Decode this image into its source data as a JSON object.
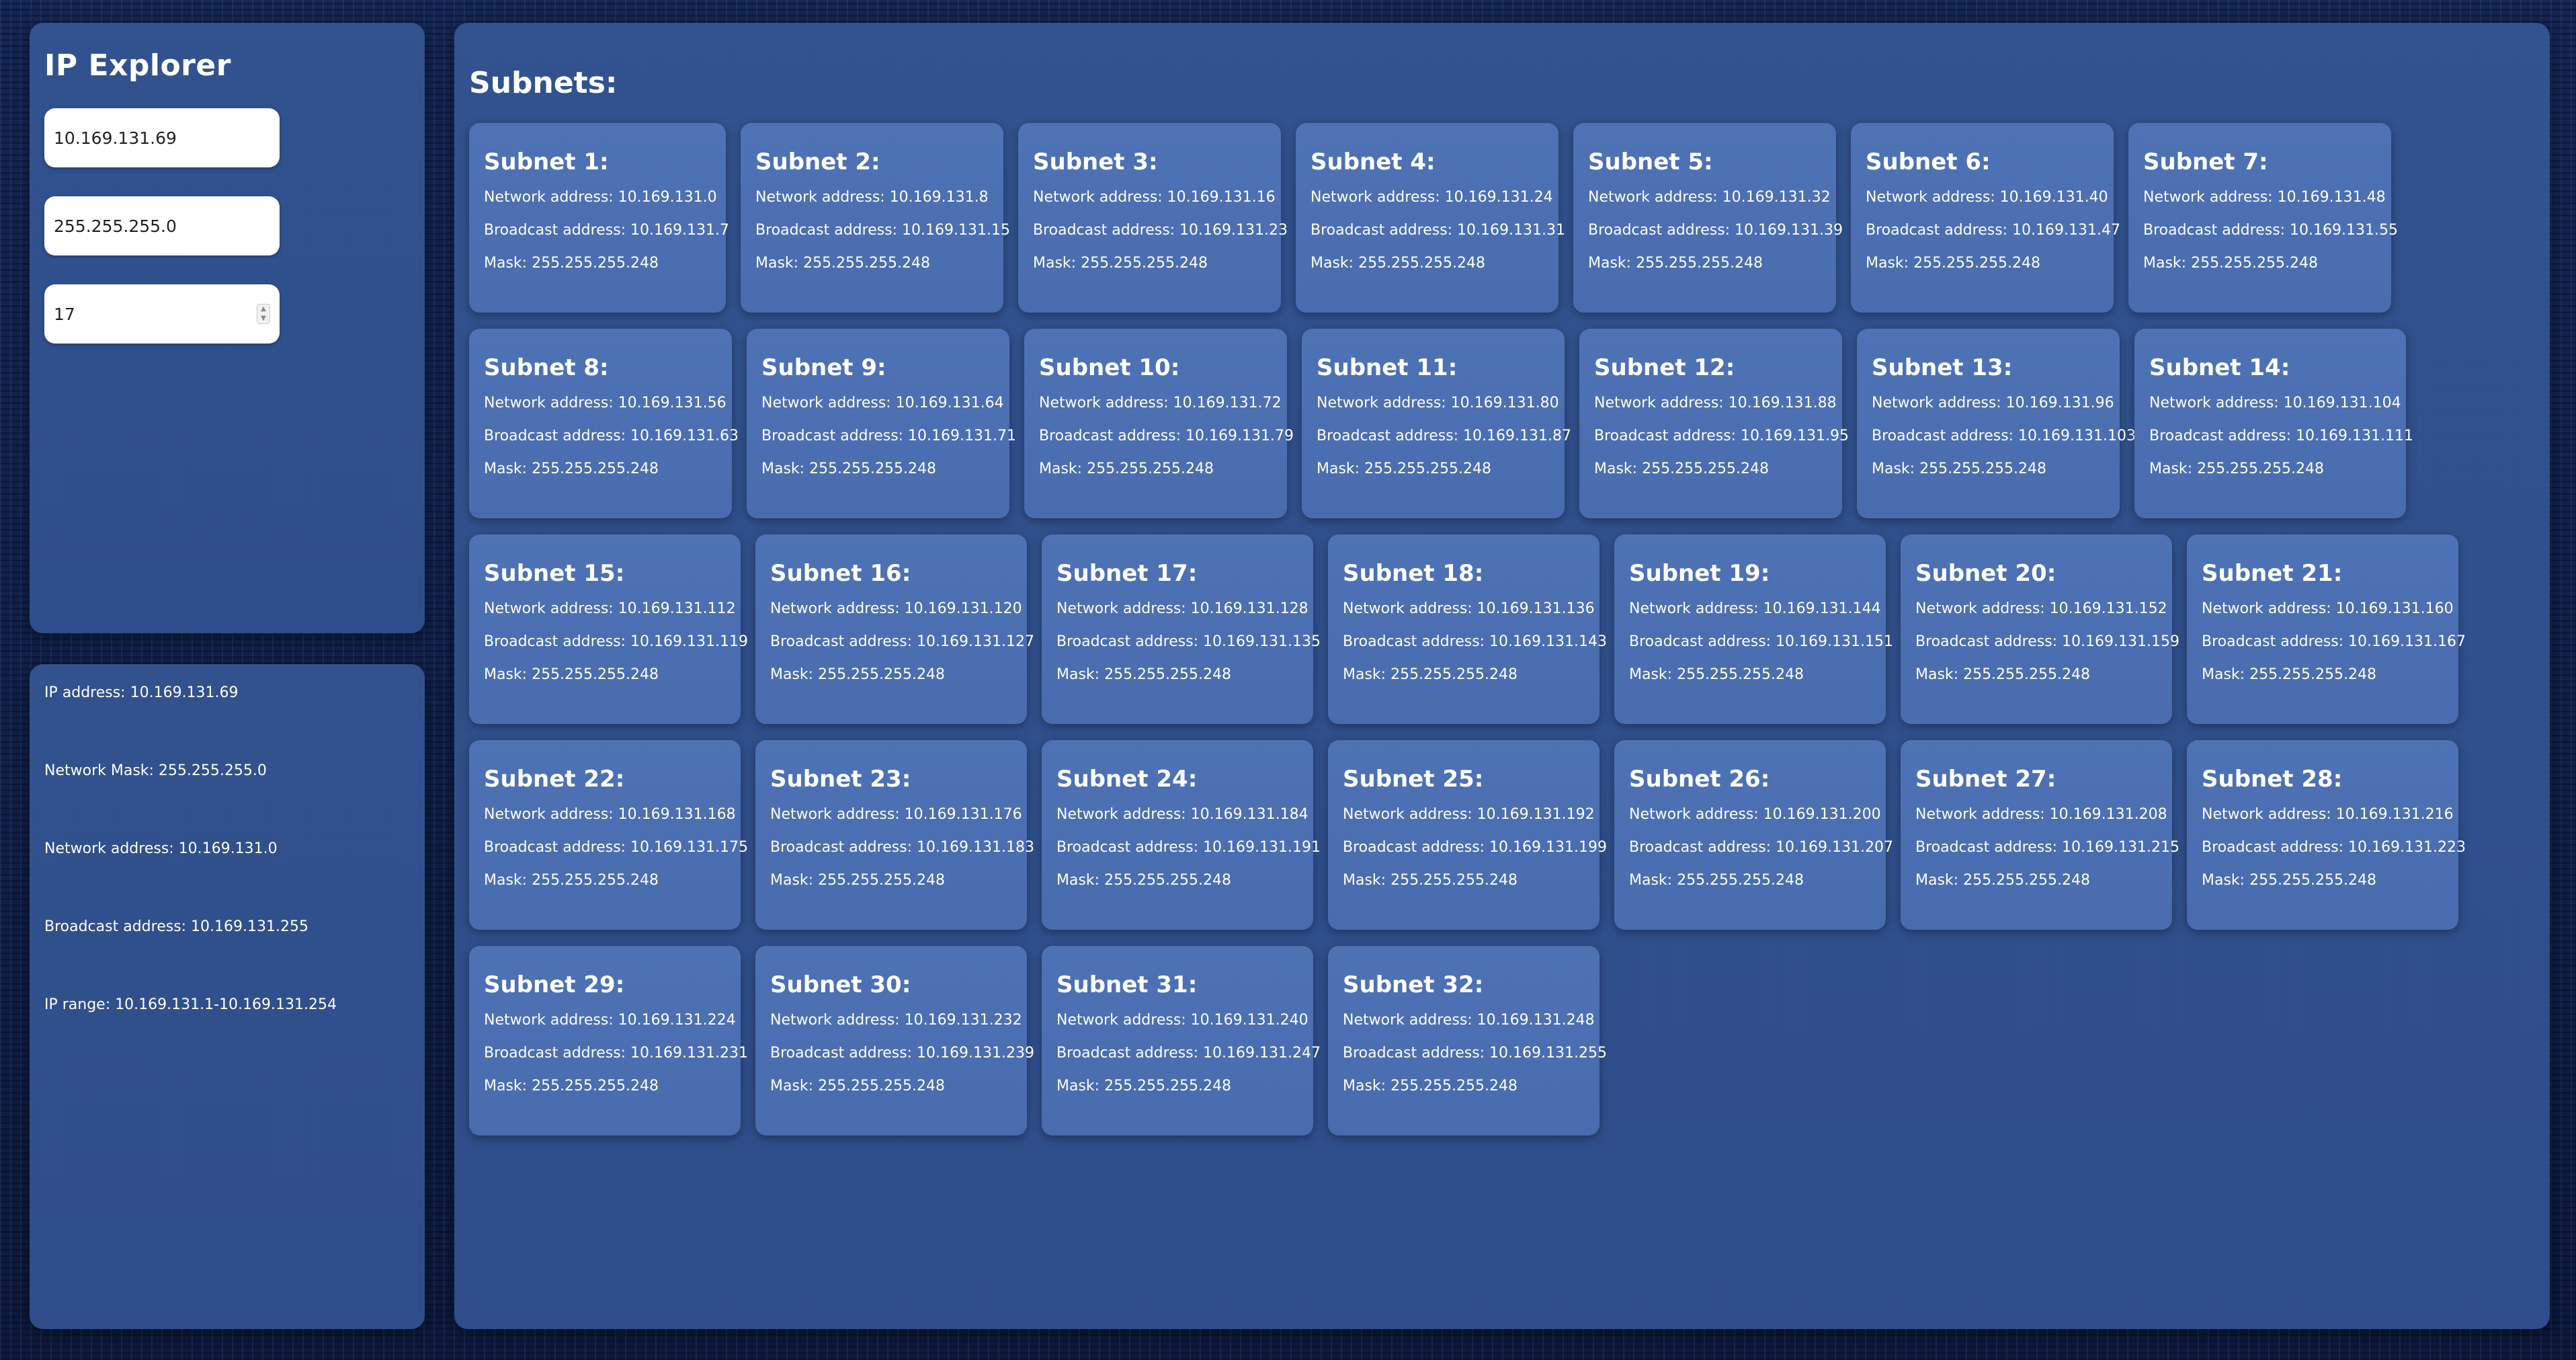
{
  "app_title": "IP Explorer",
  "inputs": {
    "ip_value": "10.169.131.69",
    "mask_value": "255.255.255.0",
    "prefix_value": "17"
  },
  "info": {
    "ip": "IP address: 10.169.131.69",
    "mask": "Network Mask: 255.255.255.0",
    "network": "Network address: 10.169.131.0",
    "broadcast": "Broadcast address: 10.169.131.255",
    "range": "IP range: 10.169.131.1-10.169.131.254"
  },
  "subnets_title": "Subnets:",
  "subnets": [
    {
      "title": "Subnet 1:",
      "network": "Network address: 10.169.131.0",
      "broadcast": "Broadcast address: 10.169.131.7",
      "mask": "Mask: 255.255.255.248"
    },
    {
      "title": "Subnet 2:",
      "network": "Network address: 10.169.131.8",
      "broadcast": "Broadcast address: 10.169.131.15",
      "mask": "Mask: 255.255.255.248"
    },
    {
      "title": "Subnet 3:",
      "network": "Network address: 10.169.131.16",
      "broadcast": "Broadcast address: 10.169.131.23",
      "mask": "Mask: 255.255.255.248"
    },
    {
      "title": "Subnet 4:",
      "network": "Network address: 10.169.131.24",
      "broadcast": "Broadcast address: 10.169.131.31",
      "mask": "Mask: 255.255.255.248"
    },
    {
      "title": "Subnet 5:",
      "network": "Network address: 10.169.131.32",
      "broadcast": "Broadcast address: 10.169.131.39",
      "mask": "Mask: 255.255.255.248"
    },
    {
      "title": "Subnet 6:",
      "network": "Network address: 10.169.131.40",
      "broadcast": "Broadcast address: 10.169.131.47",
      "mask": "Mask: 255.255.255.248"
    },
    {
      "title": "Subnet 7:",
      "network": "Network address: 10.169.131.48",
      "broadcast": "Broadcast address: 10.169.131.55",
      "mask": "Mask: 255.255.255.248"
    },
    {
      "title": "Subnet 8:",
      "network": "Network address: 10.169.131.56",
      "broadcast": "Broadcast address: 10.169.131.63",
      "mask": "Mask: 255.255.255.248"
    },
    {
      "title": "Subnet 9:",
      "network": "Network address: 10.169.131.64",
      "broadcast": "Broadcast address: 10.169.131.71",
      "mask": "Mask: 255.255.255.248"
    },
    {
      "title": "Subnet 10:",
      "network": "Network address: 10.169.131.72",
      "broadcast": "Broadcast address: 10.169.131.79",
      "mask": "Mask: 255.255.255.248"
    },
    {
      "title": "Subnet 11:",
      "network": "Network address: 10.169.131.80",
      "broadcast": "Broadcast address: 10.169.131.87",
      "mask": "Mask: 255.255.255.248"
    },
    {
      "title": "Subnet 12:",
      "network": "Network address: 10.169.131.88",
      "broadcast": "Broadcast address: 10.169.131.95",
      "mask": "Mask: 255.255.255.248"
    },
    {
      "title": "Subnet 13:",
      "network": "Network address: 10.169.131.96",
      "broadcast": "Broadcast address: 10.169.131.103",
      "mask": "Mask: 255.255.255.248"
    },
    {
      "title": "Subnet 14:",
      "network": "Network address: 10.169.131.104",
      "broadcast": "Broadcast address: 10.169.131.111",
      "mask": "Mask: 255.255.255.248"
    },
    {
      "title": "Subnet 15:",
      "network": "Network address: 10.169.131.112",
      "broadcast": "Broadcast address: 10.169.131.119",
      "mask": "Mask: 255.255.255.248"
    },
    {
      "title": "Subnet 16:",
      "network": "Network address: 10.169.131.120",
      "broadcast": "Broadcast address: 10.169.131.127",
      "mask": "Mask: 255.255.255.248"
    },
    {
      "title": "Subnet 17:",
      "network": "Network address: 10.169.131.128",
      "broadcast": "Broadcast address: 10.169.131.135",
      "mask": "Mask: 255.255.255.248"
    },
    {
      "title": "Subnet 18:",
      "network": "Network address: 10.169.131.136",
      "broadcast": "Broadcast address: 10.169.131.143",
      "mask": "Mask: 255.255.255.248"
    },
    {
      "title": "Subnet 19:",
      "network": "Network address: 10.169.131.144",
      "broadcast": "Broadcast address: 10.169.131.151",
      "mask": "Mask: 255.255.255.248"
    },
    {
      "title": "Subnet 20:",
      "network": "Network address: 10.169.131.152",
      "broadcast": "Broadcast address: 10.169.131.159",
      "mask": "Mask: 255.255.255.248"
    },
    {
      "title": "Subnet 21:",
      "network": "Network address: 10.169.131.160",
      "broadcast": "Broadcast address: 10.169.131.167",
      "mask": "Mask: 255.255.255.248"
    },
    {
      "title": "Subnet 22:",
      "network": "Network address: 10.169.131.168",
      "broadcast": "Broadcast address: 10.169.131.175",
      "mask": "Mask: 255.255.255.248"
    },
    {
      "title": "Subnet 23:",
      "network": "Network address: 10.169.131.176",
      "broadcast": "Broadcast address: 10.169.131.183",
      "mask": "Mask: 255.255.255.248"
    },
    {
      "title": "Subnet 24:",
      "network": "Network address: 10.169.131.184",
      "broadcast": "Broadcast address: 10.169.131.191",
      "mask": "Mask: 255.255.255.248"
    },
    {
      "title": "Subnet 25:",
      "network": "Network address: 10.169.131.192",
      "broadcast": "Broadcast address: 10.169.131.199",
      "mask": "Mask: 255.255.255.248"
    },
    {
      "title": "Subnet 26:",
      "network": "Network address: 10.169.131.200",
      "broadcast": "Broadcast address: 10.169.131.207",
      "mask": "Mask: 255.255.255.248"
    },
    {
      "title": "Subnet 27:",
      "network": "Network address: 10.169.131.208",
      "broadcast": "Broadcast address: 10.169.131.215",
      "mask": "Mask: 255.255.255.248"
    },
    {
      "title": "Subnet 28:",
      "network": "Network address: 10.169.131.216",
      "broadcast": "Broadcast address: 10.169.131.223",
      "mask": "Mask: 255.255.255.248"
    },
    {
      "title": "Subnet 29:",
      "network": "Network address: 10.169.131.224",
      "broadcast": "Broadcast address: 10.169.131.231",
      "mask": "Mask: 255.255.255.248"
    },
    {
      "title": "Subnet 30:",
      "network": "Network address: 10.169.131.232",
      "broadcast": "Broadcast address: 10.169.131.239",
      "mask": "Mask: 255.255.255.248"
    },
    {
      "title": "Subnet 31:",
      "network": "Network address: 10.169.131.240",
      "broadcast": "Broadcast address: 10.169.131.247",
      "mask": "Mask: 255.255.255.248"
    },
    {
      "title": "Subnet 32:",
      "network": "Network address: 10.169.131.248",
      "broadcast": "Broadcast address: 10.169.131.255",
      "mask": "Mask: 255.255.255.248"
    }
  ],
  "colors": {
    "background": "#0f1d3f",
    "panel": "#345694",
    "card": "#567cc0",
    "text": "#ffffff"
  }
}
